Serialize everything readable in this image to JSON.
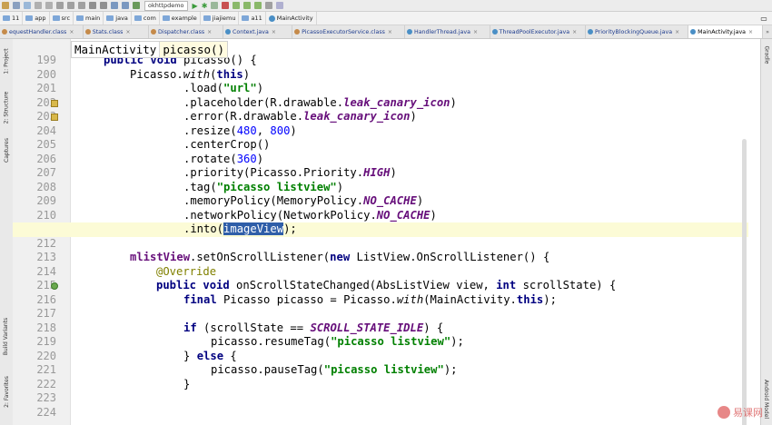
{
  "toolbar": {
    "project_selector": "okhttpdemo"
  },
  "breadcrumb": {
    "items": [
      "11",
      "app",
      "src",
      "main",
      "java",
      "com",
      "example",
      "jiajiemu",
      "a11",
      "MainActivity"
    ]
  },
  "tabs": [
    {
      "label": "equestHandler.class",
      "type": "class",
      "active": false
    },
    {
      "label": "Stats.class",
      "type": "class",
      "active": false
    },
    {
      "label": "Dispatcher.class",
      "type": "class",
      "active": false
    },
    {
      "label": "Context.java",
      "type": "java",
      "active": false
    },
    {
      "label": "PicassoExecutorService.class",
      "type": "class",
      "active": false
    },
    {
      "label": "HandlerThread.java",
      "type": "java",
      "active": false
    },
    {
      "label": "ThreadPoolExecutor.java",
      "type": "java",
      "active": false
    },
    {
      "label": "PriorityBlockingQueue.java",
      "type": "java",
      "active": false
    },
    {
      "label": "MainActivity.java",
      "type": "java",
      "active": true
    }
  ],
  "left_tool_windows": [
    "1: Project",
    "2: Structure",
    "Captures",
    "Build Variants",
    "2: Favorites"
  ],
  "right_tool_windows": [
    "Gradle",
    "Android Model"
  ],
  "method_breadcrumb": [
    "MainActivity",
    "picasso()"
  ],
  "editor": {
    "line_numbers": [
      "199",
      "200",
      "201",
      "202",
      "203",
      "204",
      "205",
      "206",
      "207",
      "208",
      "209",
      "210",
      "211",
      "212",
      "213",
      "214",
      "215",
      "216",
      "217",
      "218",
      "219",
      "220",
      "221",
      "222",
      "223",
      "224"
    ],
    "current_line": "211",
    "code": {
      "l199_kw": "public void",
      "l199_rest": " picasso() {",
      "l200_a": "Picasso.",
      "l200_b": "with",
      "l200_c": "(",
      "l200_d": "this",
      "l200_e": ")",
      "l201_a": ".load(",
      "l201_b": "\"url\"",
      "l201_c": ")",
      "l202_a": ".placeholder(R.drawable.",
      "l202_b": "leak_canary_icon",
      "l202_c": ")",
      "l203_a": ".error(R.drawable.",
      "l203_b": "leak_canary_icon",
      "l203_c": ")",
      "l204_a": ".resize(",
      "l204_b": "480",
      "l204_c": ", ",
      "l204_d": "800",
      "l204_e": ")",
      "l205": ".centerCrop()",
      "l206_a": ".rotate(",
      "l206_b": "360",
      "l206_c": ")",
      "l207_a": ".priority(Picasso.Priority.",
      "l207_b": "HIGH",
      "l207_c": ")",
      "l208_a": ".tag(",
      "l208_b": "\"picasso listview\"",
      "l208_c": ")",
      "l209_a": ".memoryPolicy(MemoryPolicy.",
      "l209_b": "NO_CACHE",
      "l209_c": ")",
      "l210_a": ".networkPolicy(NetworkPolicy.",
      "l210_b": "NO_CACHE",
      "l210_c": ")",
      "l211_a": ".into(",
      "l211_b": "imageView",
      "l211_c": ");",
      "l213_a": "mlistView",
      "l213_b": ".setOnScrollListener(",
      "l213_c": "new",
      "l213_d": " ListView.OnScrollListener() {",
      "l214": "@Override",
      "l215_a": "public void",
      "l215_b": " onScrollStateChanged(AbsListView view, ",
      "l215_c": "int",
      "l215_d": " scrollState) {",
      "l216_a": "final",
      "l216_b": " Picasso picasso = Picasso.",
      "l216_c": "with",
      "l216_d": "(MainActivity.",
      "l216_e": "this",
      "l216_f": ");",
      "l218_a": "if",
      "l218_b": " (scrollState == ",
      "l218_c": "SCROLL_STATE_IDLE",
      "l218_d": ") {",
      "l219_a": "picasso.resumeTag(",
      "l219_b": "\"picasso listview\"",
      "l219_c": ");",
      "l220_a": "} ",
      "l220_b": "else",
      "l220_c": " {",
      "l221_a": "picasso.pauseTag(",
      "l221_b": "\"picasso listview\"",
      "l221_c": ");",
      "l222": "}"
    }
  },
  "watermark": "易课网"
}
